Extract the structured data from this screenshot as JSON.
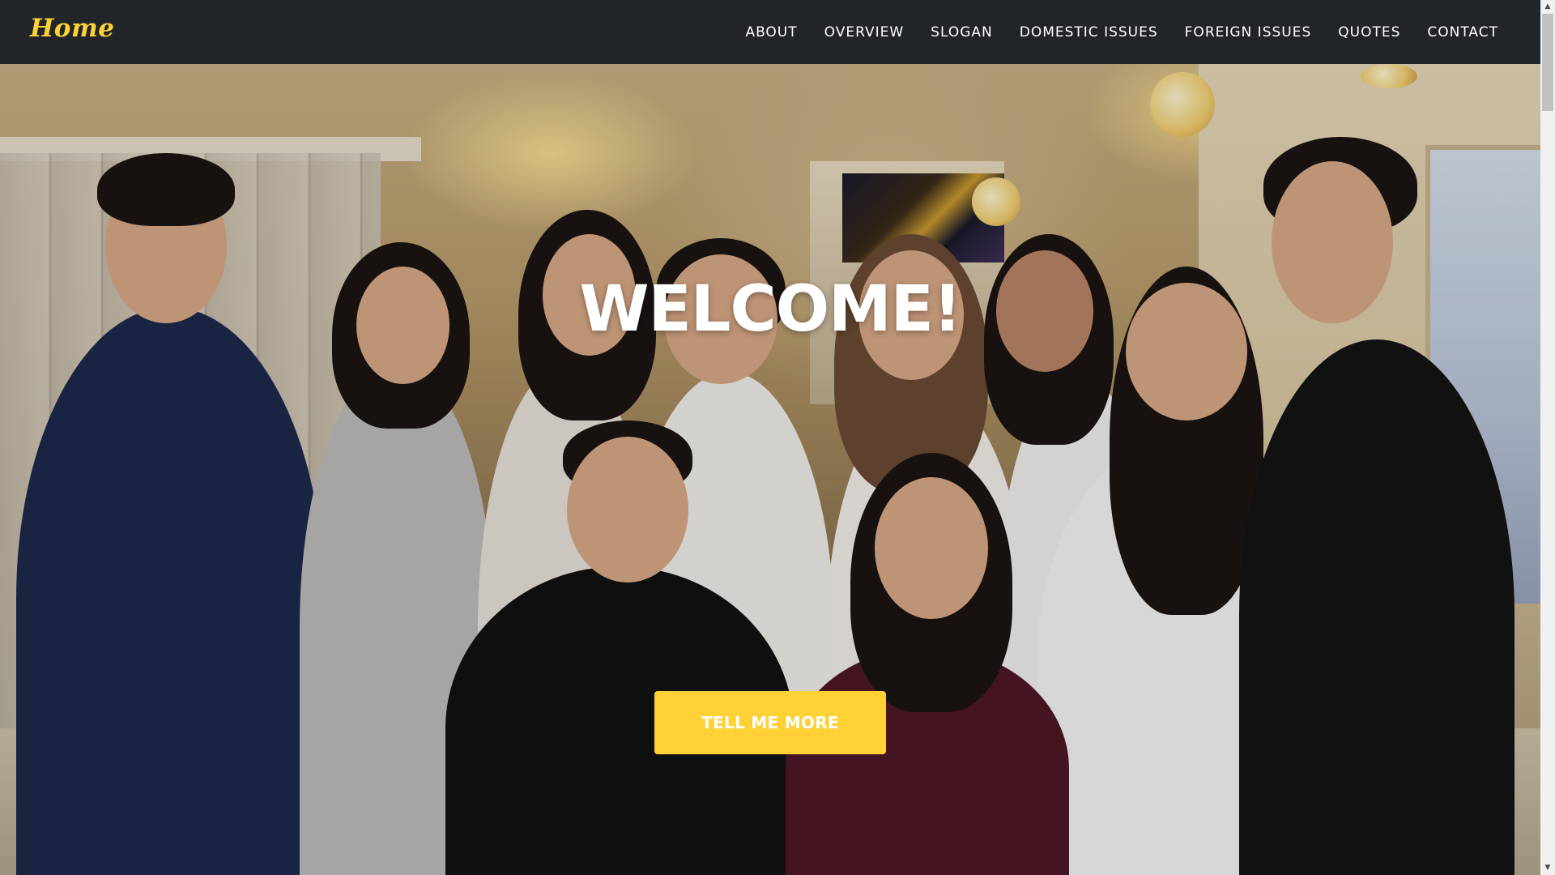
{
  "navbar": {
    "brand": "Home",
    "items": [
      {
        "label": "ABOUT"
      },
      {
        "label": "OVERVIEW"
      },
      {
        "label": "SLOGAN"
      },
      {
        "label": "DOMESTIC ISSUES"
      },
      {
        "label": "FOREIGN ISSUES"
      },
      {
        "label": "QUOTES"
      },
      {
        "label": "CONTACT"
      }
    ]
  },
  "hero": {
    "title": "WELCOME!",
    "button_label": "TELL ME MORE",
    "background_description_icon": "group-photo-hallway"
  },
  "colors": {
    "navbar_bg": "#212529",
    "accent": "#fed136",
    "hero_text": "#ffffff"
  },
  "scrollbar": {
    "up_icon": "scroll-up-arrow-icon",
    "down_icon": "scroll-down-arrow-icon"
  }
}
